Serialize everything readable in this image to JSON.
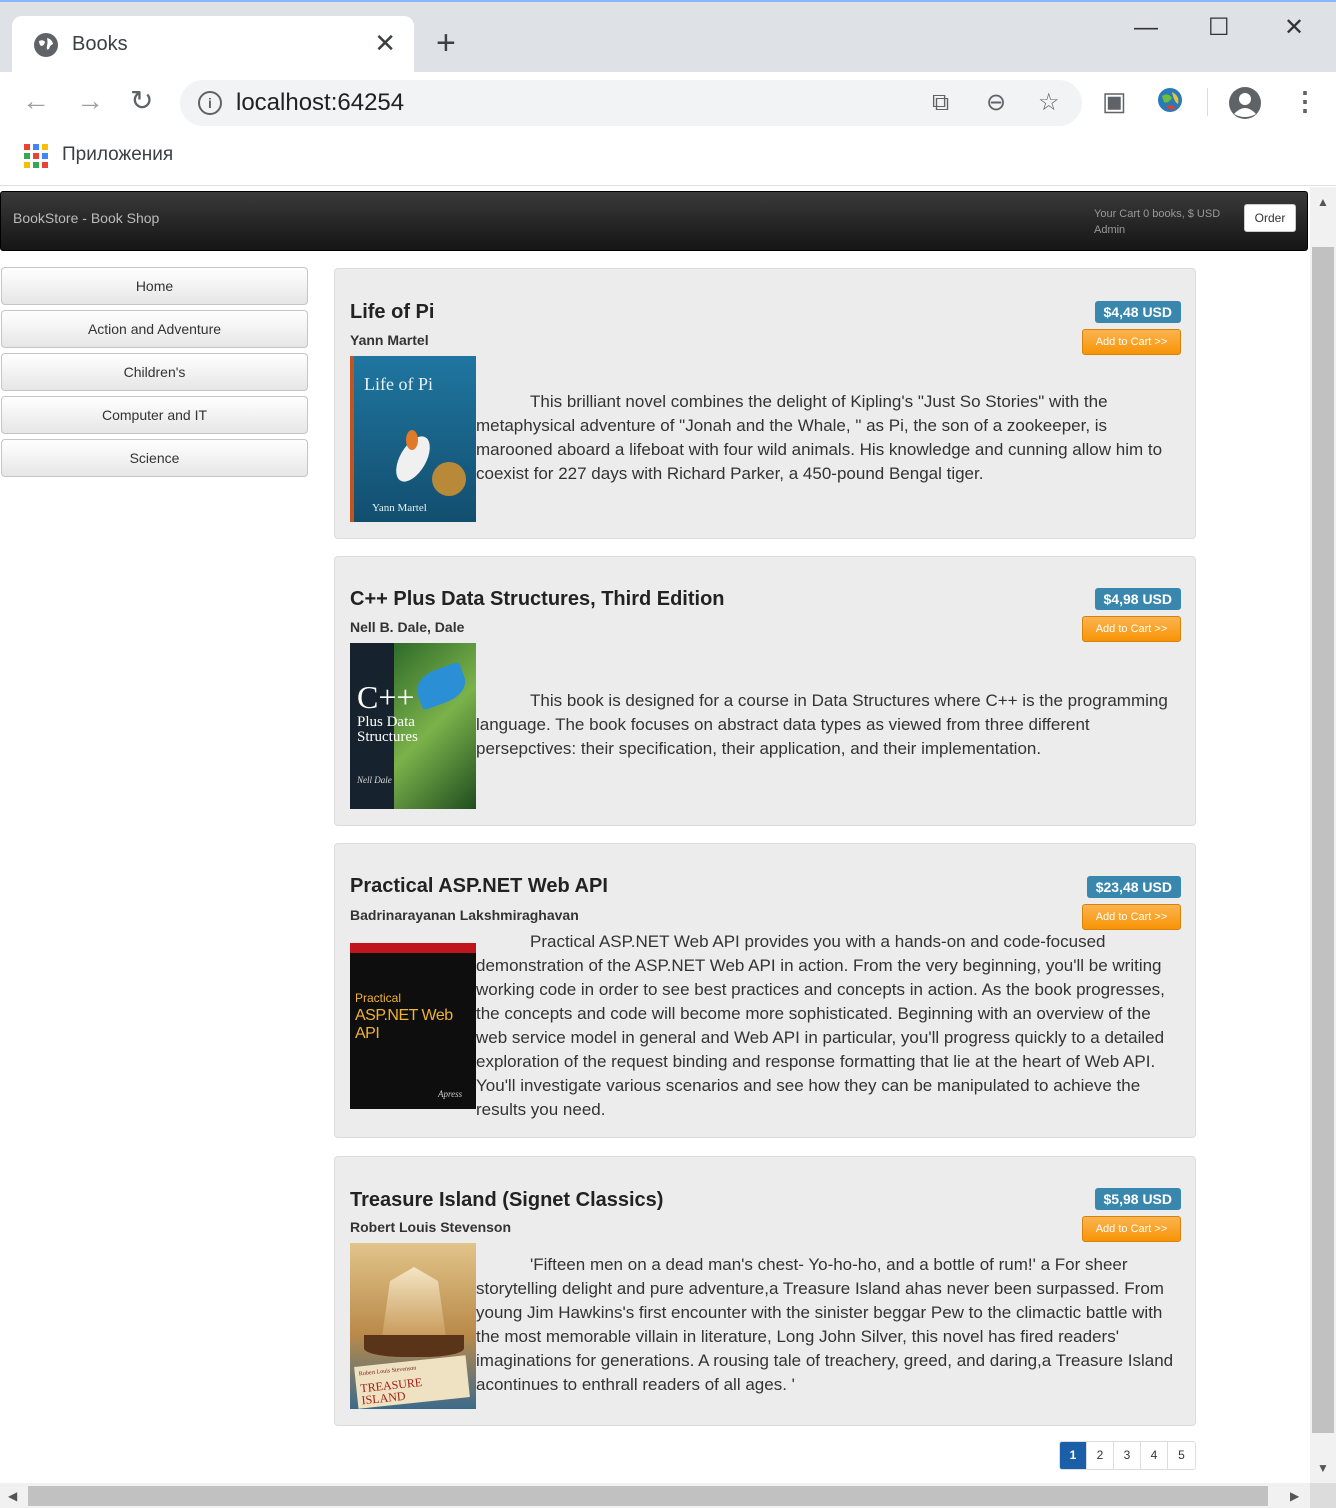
{
  "browser": {
    "tab_title": "Books",
    "tab_close": "✕",
    "new_tab": "+",
    "url": "localhost:64254",
    "bookmark_apps": "Приложения",
    "window_controls": {
      "minimize": "—",
      "maximize": "☐",
      "close": "✕"
    }
  },
  "site": {
    "brand": "BookStore - Book Shop",
    "cart_line": "Your Cart 0 books, $ USD",
    "user_line": "Admin",
    "order_label": "Order"
  },
  "sidebar": {
    "items": [
      {
        "label": "Home"
      },
      {
        "label": "Action and Adventure"
      },
      {
        "label": "Children's"
      },
      {
        "label": "Computer and IT"
      },
      {
        "label": "Science"
      }
    ]
  },
  "books": [
    {
      "title": "Life of Pi",
      "author": "Yann Martel",
      "price": "$4,48 USD",
      "add_label": "Add to Cart >>",
      "description": "This brilliant novel combines the delight of Kipling's \"Just So Stories\" with the metaphysical adventure of \"Jonah and the Whale, \" as Pi, the son of a zookeeper, is marooned aboard a lifeboat with four wild animals. His knowledge and cunning allow him to coexist for 227 days with Richard Parker, a 450-pound Bengal tiger.",
      "cover_title": "Life of Pi",
      "cover_author": "Yann Martel",
      "cover_color": "#1d6a8f"
    },
    {
      "title": "C++ Plus Data Structures, Third Edition",
      "author": "Nell B. Dale, Dale",
      "price": "$4,98 USD",
      "add_label": "Add to Cart >>",
      "description": "This book is designed for a course in Data Structures where C++ is the programming language. The book focuses on abstract data types as viewed from three different persepctives: their specification, their application, and their implementation.",
      "cover_title": "C++",
      "cover_subtitle": "Plus Data Structures",
      "cover_author": "Nell Dale",
      "cover_color": "#1b2a3a"
    },
    {
      "title": "Practical ASP.NET Web API",
      "author": "Badrinarayanan Lakshmiraghavan",
      "price": "$23,48 USD",
      "add_label": "Add to Cart >>",
      "description": "Practical ASP.NET Web API provides you with a hands-on and code-focused demonstration of the ASP.NET Web API in action. From the very beginning, you'll be writing working code in order to see best practices and concepts in action. As the book progresses, the concepts and code will become more sophisticated. Beginning with an overview of the web service model in general and Web API in particular, you'll progress quickly to a detailed exploration of the request binding and response formatting that lie at the heart of Web API. You'll investigate various scenarios and see how they can be manipulated to achieve the results you need.",
      "cover_kicker": "Practical",
      "cover_title": "ASP.NET Web API",
      "cover_publisher": "Apress",
      "cover_color": "#111111"
    },
    {
      "title": "Treasure Island (Signet Classics)",
      "author": "Robert Louis Stevenson",
      "price": "$5,98 USD",
      "add_label": "Add to Cart >>",
      "description": "'Fifteen men on a dead man's chest- Yo-ho-ho, and a bottle of rum!' a For sheer storytelling delight and pure adventure,a Treasure Island ahas never been surpassed. From young Jim Hawkins's first encounter with the sinister beggar Pew to the climactic battle with the most memorable villain in literature, Long John Silver, this novel has fired readers' imaginations for generations. A rousing tale of treachery, greed, and daring,a Treasure Island acontinues to enthrall readers of all ages. '",
      "cover_title": "TREASURE ISLAND",
      "cover_author": "Robert Louis Stevenson",
      "cover_color": "#c8a060"
    }
  ],
  "pagination": {
    "pages": [
      "1",
      "2",
      "3",
      "4",
      "5"
    ],
    "current": "1"
  }
}
